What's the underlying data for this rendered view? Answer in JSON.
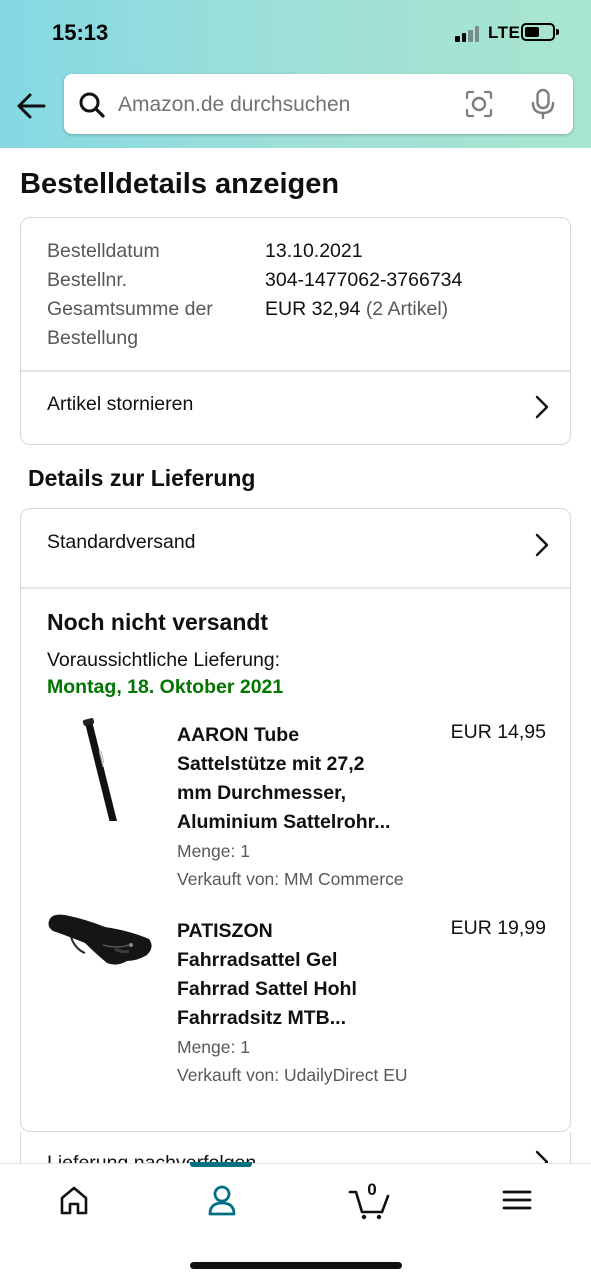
{
  "status_bar": {
    "time": "15:13",
    "network": "LTE"
  },
  "search": {
    "placeholder": "Amazon.de durchsuchen"
  },
  "page_title": "Bestelldetails anzeigen",
  "order_info": {
    "date_label": "Bestelldatum",
    "date_value": "13.10.2021",
    "number_label": "Bestellnr.",
    "number_value": "304-1477062-3766734",
    "total_label_line1": "Gesamtsumme der",
    "total_label_line2": "Bestellung",
    "total_value": "EUR 32,94",
    "total_count": "(2 Artikel)",
    "cancel_label": "Artikel stornieren"
  },
  "delivery": {
    "section_title": "Details zur Lieferung",
    "shipping_method": "Standardversand",
    "status": "Noch nicht versandt",
    "expected_label": "Voraussichtliche Lieferung:",
    "expected_date": "Montag, 18. Oktober 2021",
    "accent_green": "#007600",
    "items": [
      {
        "title_line1": "AARON Tube",
        "title_line2": "Sattelstütze mit 27,2",
        "title_line3": "mm Durchmesser,",
        "title_line4": "Aluminium Sattelrohr...",
        "price": "EUR 14,95",
        "quantity": "Menge: 1",
        "seller": "Verkauft von: MM Commerce",
        "icon": "seatpost-image"
      },
      {
        "title_line1": "PATISZON",
        "title_line2": "Fahrradsattel Gel",
        "title_line3": "Fahrrad Sattel Hohl",
        "title_line4": "Fahrradsitz MTB...",
        "price": "EUR 19,99",
        "quantity": "Menge: 1",
        "seller": "Verkauft von: UdailyDirect EU",
        "icon": "saddle-image"
      }
    ],
    "track_label": "Lieferung nachverfolgen"
  },
  "bottom_nav": {
    "cart_count": "0",
    "accent": "#007185",
    "items": [
      "home-icon",
      "account-icon",
      "cart-icon",
      "menu-icon"
    ]
  }
}
